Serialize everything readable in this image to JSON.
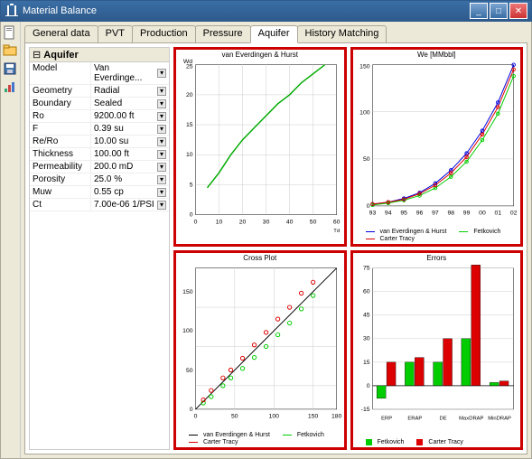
{
  "window": {
    "title": "Material Balance"
  },
  "tabs": [
    "General data",
    "PVT",
    "Production",
    "Pressure",
    "Aquifer",
    "History Matching"
  ],
  "active_tab": "Aquifer",
  "properties": {
    "section": "Aquifer",
    "rows": [
      {
        "name": "Model",
        "value": "Van Everdinge..."
      },
      {
        "name": "Geometry",
        "value": "Radial"
      },
      {
        "name": "Boundary",
        "value": "Sealed"
      },
      {
        "name": "Ro",
        "value": "9200.00 ft"
      },
      {
        "name": "F",
        "value": "0.39 su"
      },
      {
        "name": "Re/Ro",
        "value": "10.00 su"
      },
      {
        "name": "Thickness",
        "value": "100.00 ft"
      },
      {
        "name": "Permeability",
        "value": "200.0 mD"
      },
      {
        "name": "Porosity",
        "value": "25.0 %"
      },
      {
        "name": "Muw",
        "value": "0.55 cp"
      },
      {
        "name": "Ct",
        "value": "7.00e-06 1/PSI"
      }
    ]
  },
  "chart_data": [
    {
      "type": "line",
      "title": "van Everdingen & Hurst",
      "xlabel": "Td",
      "ylabel": "Wd",
      "xlim": [
        0,
        60
      ],
      "ylim": [
        0,
        25
      ],
      "series": [
        {
          "name": "van Everdingen & Hurst",
          "color": "#0a0",
          "x": [
            5,
            10,
            15,
            20,
            25,
            30,
            35,
            40,
            45,
            50,
            55
          ],
          "y": [
            4.5,
            7,
            10,
            12.5,
            14.5,
            16.5,
            18.5,
            20,
            22,
            23.5,
            25
          ]
        }
      ]
    },
    {
      "type": "line",
      "title": "We [MMbbl]",
      "xlabel": "",
      "ylabel": "",
      "xticks": [
        "93",
        "94",
        "95",
        "96",
        "97",
        "98",
        "99",
        "00",
        "01",
        "02"
      ],
      "ylim": [
        0,
        150
      ],
      "series": [
        {
          "name": "van Everdingen & Hurst",
          "color": "#00d",
          "x": [
            0,
            1,
            2,
            3,
            4,
            5,
            6,
            7,
            8,
            9
          ],
          "y": [
            2,
            4,
            8,
            14,
            24,
            38,
            56,
            80,
            110,
            150
          ]
        },
        {
          "name": "Fetkovich",
          "color": "#0c0",
          "x": [
            0,
            1,
            2,
            3,
            4,
            5,
            6,
            7,
            8,
            9
          ],
          "y": [
            1,
            3,
            6,
            11,
            19,
            31,
            47,
            70,
            98,
            138
          ]
        },
        {
          "name": "Carter Tracy",
          "color": "#d00",
          "x": [
            0,
            1,
            2,
            3,
            4,
            5,
            6,
            7,
            8,
            9
          ],
          "y": [
            2,
            4,
            7,
            13,
            22,
            35,
            52,
            76,
            105,
            145
          ]
        }
      ]
    },
    {
      "type": "scatter",
      "title": "Cross Plot",
      "xlabel": "",
      "ylabel": "",
      "xlim": [
        0,
        180
      ],
      "ylim": [
        0,
        180
      ],
      "series": [
        {
          "name": "van Everdingen & Hurst",
          "color": "#000",
          "kind": "line",
          "x": [
            0,
            180
          ],
          "y": [
            0,
            180
          ]
        },
        {
          "name": "Fetkovich",
          "color": "#0c0",
          "kind": "points",
          "x": [
            10,
            20,
            35,
            45,
            60,
            75,
            90,
            105,
            120,
            135,
            150
          ],
          "y": [
            8,
            16,
            30,
            40,
            52,
            66,
            80,
            95,
            110,
            128,
            145
          ]
        },
        {
          "name": "Carter Tracy",
          "color": "#d00",
          "kind": "points",
          "x": [
            10,
            20,
            35,
            45,
            60,
            75,
            90,
            105,
            120,
            135,
            150
          ],
          "y": [
            12,
            24,
            40,
            50,
            65,
            82,
            98,
            115,
            130,
            148,
            162
          ]
        }
      ]
    },
    {
      "type": "bar",
      "title": "Errors",
      "xlabel": "",
      "ylabel": "",
      "ylim": [
        -15,
        75
      ],
      "categories": [
        "ERP",
        "ERAP",
        "DE",
        "MaxDRAP",
        "MinDRAP"
      ],
      "series": [
        {
          "name": "Fetkovich",
          "color": "#0c0",
          "values": [
            -8,
            15,
            15,
            30,
            2
          ]
        },
        {
          "name": "Carter Tracy",
          "color": "#d00",
          "values": [
            15,
            18,
            30,
            77,
            3
          ]
        }
      ]
    }
  ]
}
